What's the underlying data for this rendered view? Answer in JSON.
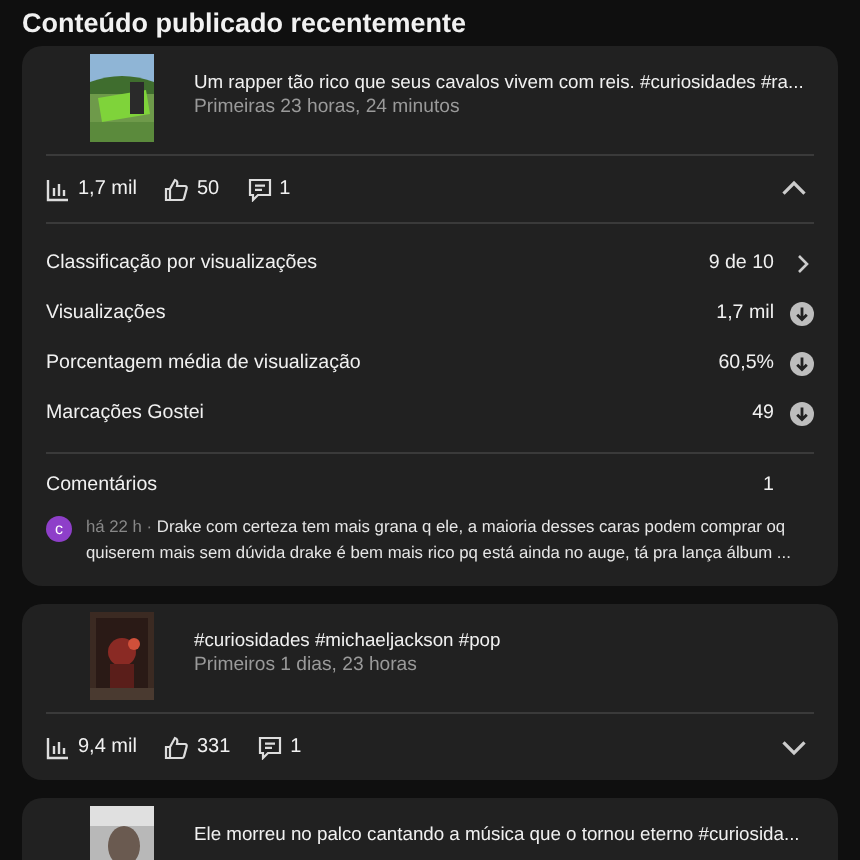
{
  "heading": "Conteúdo publicado recentemente",
  "videos": [
    {
      "title": "Um rapper tão rico que seus cavalos vivem com reis. #curiosidades #ra...",
      "age": "Primeiras 23 horas, 24 minutos",
      "views": "1,7 mil",
      "likes": "50",
      "comments": "1",
      "expanded": true,
      "metrics": [
        {
          "kind": "link",
          "label": "Classificação por visualizações",
          "value": "9 de 10"
        },
        {
          "kind": "trend",
          "label": "Visualizações",
          "value": "1,7 mil"
        },
        {
          "kind": "trend",
          "label": "Porcentagem média de visualização",
          "value": "60,5%"
        },
        {
          "kind": "trend",
          "label": "Marcações Gostei",
          "value": "49"
        }
      ],
      "comments_section": {
        "label": "Comentários",
        "count": "1",
        "items": [
          {
            "avatar": "c",
            "color": "#8e3fc9",
            "time": "há 22 h ·",
            "text": "Drake com certeza tem mais grana q ele, a maioria desses caras podem comprar oq quiserem mais sem dúvida drake é bem mais rico pq está ainda no auge, tá pra lança álbum ..."
          }
        ]
      }
    },
    {
      "title": "#curiosidades #michaeljackson #pop",
      "age": "Primeiros 1 dias, 23 horas",
      "views": "9,4 mil",
      "likes": "331",
      "comments": "1",
      "expanded": false
    },
    {
      "title": "Ele morreu no palco cantando a música que o tornou eterno #curiosida..."
    }
  ]
}
